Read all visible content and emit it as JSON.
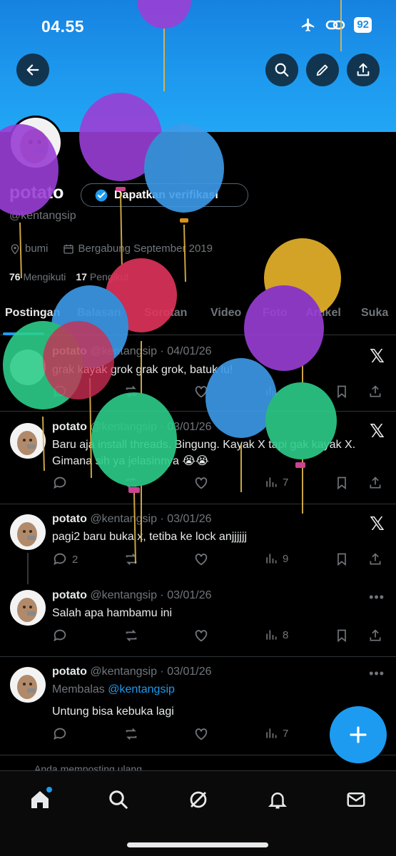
{
  "status": {
    "time": "04.55",
    "battery": "92"
  },
  "profile": {
    "name": "potato",
    "handle": "@kentangsip",
    "verify_label": "Dapatkan verifikasi",
    "location": "bumi",
    "joined": "Bergabung September 2019",
    "following_count": "76",
    "following_label": "Mengikuti",
    "followers_count": "17",
    "followers_label": "Pengikut"
  },
  "tabs": [
    "Postingan",
    "Balasan",
    "Sorotan",
    "Video",
    "Foto",
    "Artikel",
    "Suka"
  ],
  "posts": [
    {
      "name": "potato",
      "handle": "@kentangsip",
      "date": "04/01/26",
      "text": "grak kayak grok grak grok, batuk lu!",
      "views": ""
    },
    {
      "name": "potato",
      "handle": "@kentangsip",
      "date": "03/01/26",
      "text": "Baru aja install threads. Bingung. Kayak X tapi gak kayak X. Gimana sih ya jelasinnya 😭😭",
      "views": "7"
    },
    {
      "name": "potato",
      "handle": "@kentangsip",
      "date": "03/01/26",
      "text": "pagi2 baru buka x, tetiba ke lock anjjjjjj",
      "replies": "2",
      "views": "9"
    },
    {
      "name": "potato",
      "handle": "@kentangsip",
      "date": "03/01/26",
      "text": "Salah apa hambamu ini",
      "views": "8"
    },
    {
      "name": "potato",
      "handle": "@kentangsip",
      "date": "03/01/26",
      "reply_prefix": "Membalas",
      "reply_handle": "@kentangsip",
      "text": "Untung bisa kebuka lagi",
      "views": "7"
    }
  ],
  "repost_note": "Anda memposting ulang",
  "nav": [
    "home-icon",
    "search-icon",
    "grok-icon",
    "bell-icon",
    "mail-icon"
  ],
  "colors": {
    "accent": "#1d9bf0",
    "banner": "#1d98ee",
    "background": "#000000"
  }
}
